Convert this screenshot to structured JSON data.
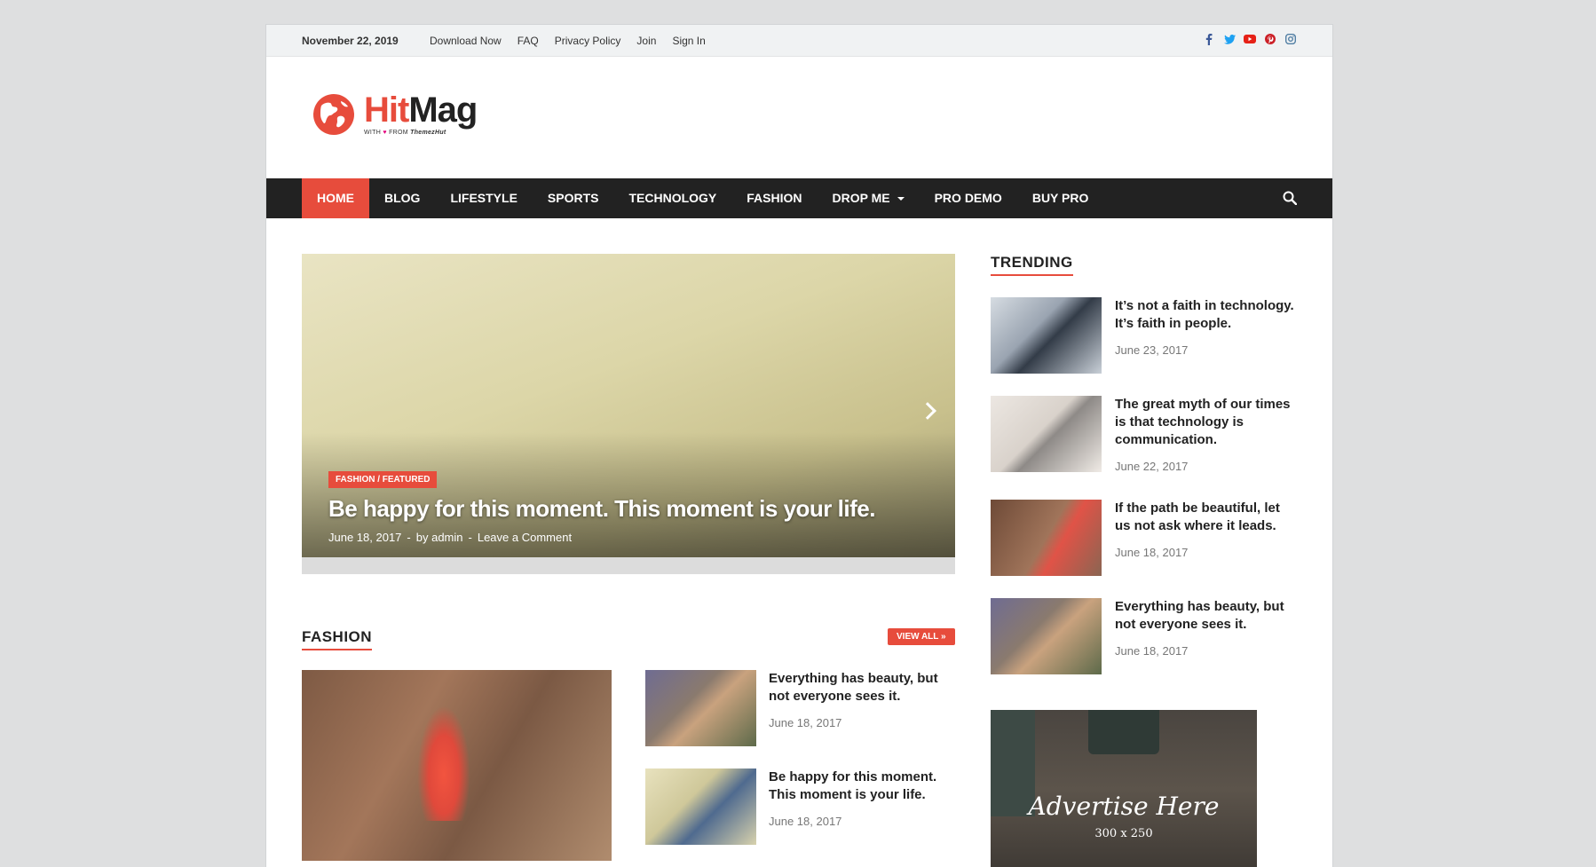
{
  "topbar": {
    "date": "November 22, 2019",
    "links": [
      "Download Now",
      "FAQ",
      "Privacy Policy",
      "Join",
      "Sign In"
    ],
    "social_icons": [
      "facebook-icon",
      "twitter-icon",
      "youtube-icon",
      "pinterest-icon",
      "instagram-icon"
    ]
  },
  "logo": {
    "brand_hit": "Hit",
    "brand_mag": "Mag",
    "tag_with": "WITH",
    "tag_from": "FROM",
    "tag_company": "ThemezHut"
  },
  "nav": {
    "items": [
      "HOME",
      "BLOG",
      "LIFESTYLE",
      "SPORTS",
      "TECHNOLOGY",
      "FASHION",
      "DROP ME",
      "PRO DEMO",
      "BUY PRO"
    ],
    "active": "HOME"
  },
  "slider": {
    "category": "FASHION / FEATURED",
    "title": "Be happy for this moment. This moment is your life.",
    "date": "June 18, 2017",
    "sep": "-",
    "author": "by admin",
    "comment": "Leave a Comment"
  },
  "fashion": {
    "title": "FASHION",
    "view_all": "VIEW ALL »",
    "items": [
      {
        "title": "Everything has beauty, but not everyone sees it.",
        "date": "June 18, 2017"
      },
      {
        "title": "Be happy for this moment. This moment is your life.",
        "date": "June 18, 2017"
      }
    ]
  },
  "trending": {
    "title": "TRENDING",
    "items": [
      {
        "title": "It’s not a faith in technology. It’s faith in people.",
        "date": "June 23, 2017"
      },
      {
        "title": "The great myth of our times is that technology is communication.",
        "date": "June 22, 2017"
      },
      {
        "title": "If the path be beautiful, let us not ask where it leads.",
        "date": "June 18, 2017"
      },
      {
        "title": "Everything has beauty, but not everyone sees it.",
        "date": "June 18, 2017"
      }
    ]
  },
  "advert": {
    "line1": "Advertise Here",
    "line2": "300 x 250"
  },
  "colors": {
    "accent": "#e74c3c",
    "nav_bg": "#222222",
    "page_bg": "#dedfe0"
  }
}
